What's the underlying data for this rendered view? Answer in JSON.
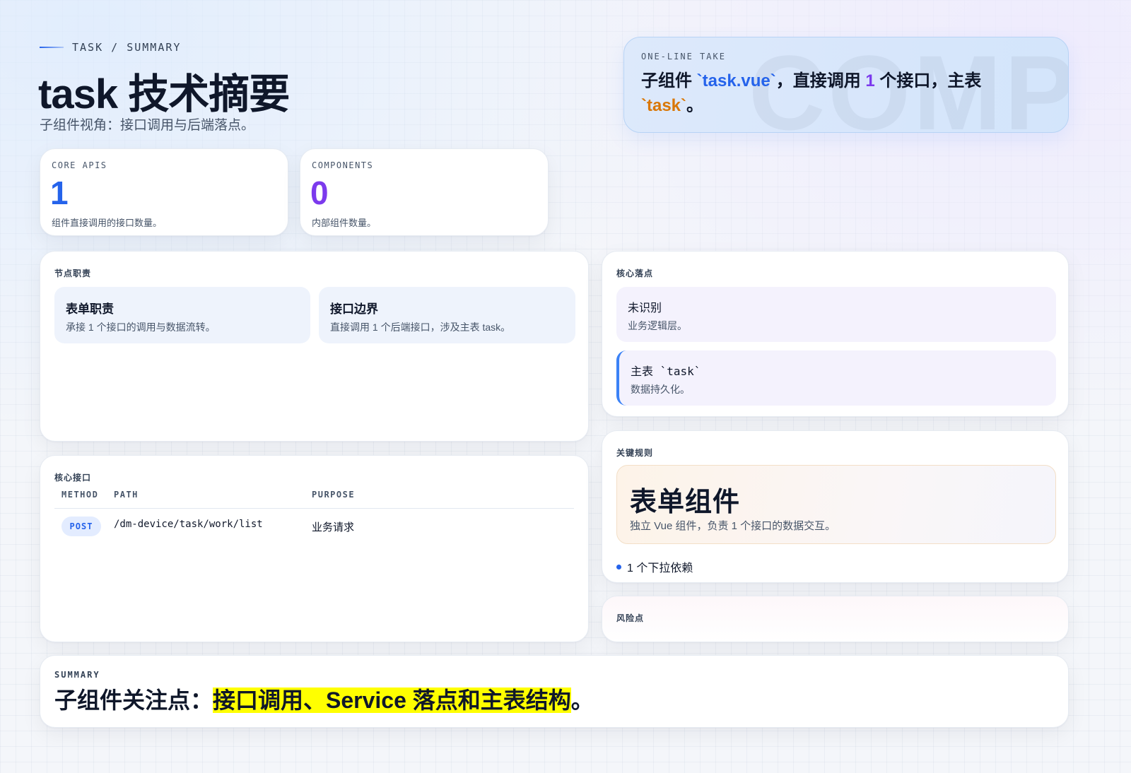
{
  "header": {
    "eyebrow": "TASK / SUMMARY",
    "title": "task 技术摘要",
    "subtitle": "子组件视角：接口调用与后端落点。"
  },
  "take": {
    "label": "ONE-LINE TAKE",
    "watermark": "COMP",
    "text_prefix": "子组件 ",
    "component": "`task.vue`",
    "text_mid": "，直接调用 ",
    "api_count": "1",
    "text_mid2": " 个接口，主表 ",
    "table": "`task`",
    "text_suffix": "。"
  },
  "stats": [
    {
      "label": "CORE APIS",
      "value": "1",
      "desc": "组件直接调用的接口数量。",
      "color": "#2563eb"
    },
    {
      "label": "COMPONENTS",
      "value": "0",
      "desc": "内部组件数量。",
      "color": "#7c3aed"
    }
  ],
  "duties": {
    "label": "节点职责",
    "items": [
      {
        "title": "表单职责",
        "desc": "承接 1 个接口的调用与数据流转。"
      },
      {
        "title": "接口边界",
        "desc": "直接调用 1 个后端接口，涉及主表 task。"
      }
    ]
  },
  "landing": {
    "label": "核心落点",
    "items": [
      {
        "title": "未识别",
        "desc": "业务逻辑层。"
      },
      {
        "title": "主表 `task`",
        "desc": "数据持久化。"
      }
    ]
  },
  "apis": {
    "label": "核心接口",
    "columns": [
      "METHOD",
      "PATH",
      "PURPOSE"
    ],
    "rows": [
      {
        "method": "POST",
        "path": "/dm-device/task/work/list",
        "purpose": "业务请求"
      }
    ]
  },
  "rules": {
    "label": "关键规则",
    "title": "表单组件",
    "desc": "独立 Vue 组件，负责 1 个接口的数据交互。",
    "bullets": [
      "1 个下拉依赖"
    ]
  },
  "risk": {
    "label": "风险点"
  },
  "summary": {
    "label": "SUMMARY",
    "prefix": "子组件关注点：",
    "highlight": "接口调用、Service 落点和主表结构",
    "suffix": "。"
  }
}
